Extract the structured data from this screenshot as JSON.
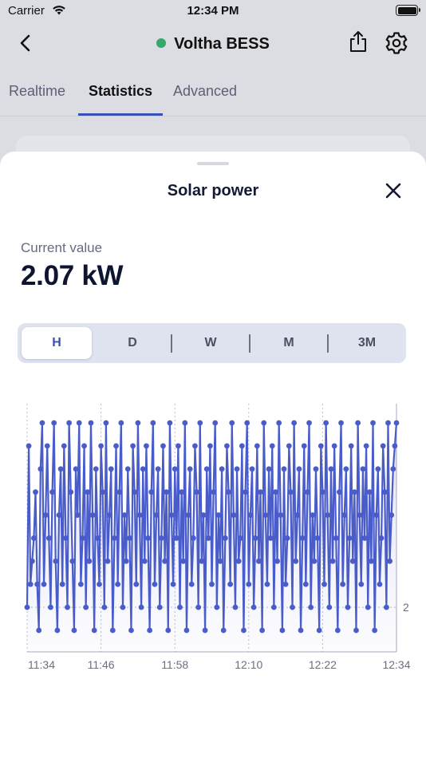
{
  "status_bar": {
    "carrier": "Carrier",
    "time": "12:34 PM"
  },
  "nav": {
    "title": "Voltha BESS",
    "status_color": "#37a86b"
  },
  "tabs": [
    {
      "label": "Realtime",
      "active": false
    },
    {
      "label": "Statistics",
      "active": true
    },
    {
      "label": "Advanced",
      "active": false
    }
  ],
  "sheet": {
    "title": "Solar power",
    "current_value_label": "Current value",
    "current_value": "2.07 kW"
  },
  "segments": [
    {
      "label": "H",
      "active": true
    },
    {
      "label": "D",
      "active": false
    },
    {
      "label": "W",
      "active": false
    },
    {
      "label": "M",
      "active": false
    },
    {
      "label": "3M",
      "active": false
    }
  ],
  "colors": {
    "accent": "#3950b9",
    "series": "#4a5cc9"
  },
  "chart_data": {
    "type": "line",
    "x_tick_labels": [
      "11:34",
      "11:46",
      "11:58",
      "12:10",
      "12:22",
      "12:34"
    ],
    "y_tick_labels": [
      "2"
    ],
    "y_levels": [
      1.9,
      2.0,
      2.1,
      2.2,
      2.3,
      2.4,
      2.5,
      2.6,
      2.7,
      2.8
    ],
    "ylim": [
      1.9,
      2.8
    ],
    "grid": "vertical dotted at x ticks, horizontal dotted at y ticks",
    "series": [
      {
        "values": [
          2.0,
          2.7,
          2.1,
          2.2,
          2.3,
          2.5,
          2.1,
          1.9,
          2.6,
          2.8,
          2.1,
          2.4,
          2.7,
          2.3,
          2.0,
          2.5,
          2.8,
          2.2,
          1.9,
          2.4,
          2.6,
          2.1,
          2.7,
          2.3,
          2.0,
          2.8,
          2.5,
          2.2,
          1.9,
          2.6,
          2.4,
          2.8,
          2.1,
          2.3,
          2.7,
          2.0,
          2.5,
          2.2,
          2.8,
          2.4,
          1.9,
          2.6,
          2.3,
          2.1,
          2.7,
          2.5,
          2.0,
          2.8,
          2.2,
          2.4,
          2.6,
          1.9,
          2.3,
          2.7,
          2.1,
          2.5,
          2.8,
          2.0,
          2.4,
          2.2,
          2.6,
          2.3,
          1.9,
          2.7,
          2.5,
          2.1,
          2.8,
          2.4,
          2.0,
          2.6,
          2.2,
          2.7,
          2.3,
          1.9,
          2.5,
          2.8,
          2.1,
          2.4,
          2.6,
          2.0,
          2.3,
          2.7,
          2.2,
          2.5,
          1.9,
          2.8,
          2.4,
          2.1,
          2.6,
          2.3,
          2.7,
          2.0,
          2.5,
          2.2,
          2.8,
          1.9,
          2.4,
          2.6,
          2.1,
          2.3,
          2.7,
          2.5,
          2.0,
          2.8,
          2.2,
          2.4,
          1.9,
          2.6,
          2.3,
          2.7,
          2.1,
          2.5,
          2.8,
          2.0,
          2.4,
          2.2,
          2.6,
          1.9,
          2.3,
          2.7,
          2.5,
          2.1,
          2.8,
          2.4,
          2.0,
          2.6,
          2.2,
          2.3,
          2.7,
          1.9,
          2.5,
          2.8,
          2.1,
          2.4,
          2.6,
          2.0,
          2.3,
          2.7,
          2.2,
          2.5,
          1.9,
          2.8,
          2.4,
          2.1,
          2.6,
          2.3,
          2.7,
          2.0,
          2.5,
          2.2,
          2.8,
          2.4,
          1.9,
          2.6,
          2.1,
          2.3,
          2.7,
          2.5,
          2.0,
          2.8,
          2.2,
          2.4,
          2.6,
          1.9,
          2.3,
          2.7,
          2.1,
          2.5,
          2.8,
          2.0,
          2.4,
          2.2,
          2.6,
          2.3,
          1.9,
          2.7,
          2.5,
          2.1,
          2.8,
          2.4,
          2.0,
          2.6,
          2.2,
          2.7,
          2.3,
          1.9,
          2.5,
          2.8,
          2.1,
          2.4,
          2.6,
          2.0,
          2.3,
          2.7,
          2.2,
          2.5,
          1.9,
          2.8,
          2.4,
          2.1,
          2.6,
          2.3,
          2.7,
          2.0,
          2.5,
          2.2,
          2.8,
          1.9,
          2.4,
          2.6,
          2.1,
          2.3,
          2.7,
          2.5,
          2.0,
          2.8,
          2.2,
          2.4,
          2.6,
          2.7,
          2.8
        ]
      }
    ]
  }
}
